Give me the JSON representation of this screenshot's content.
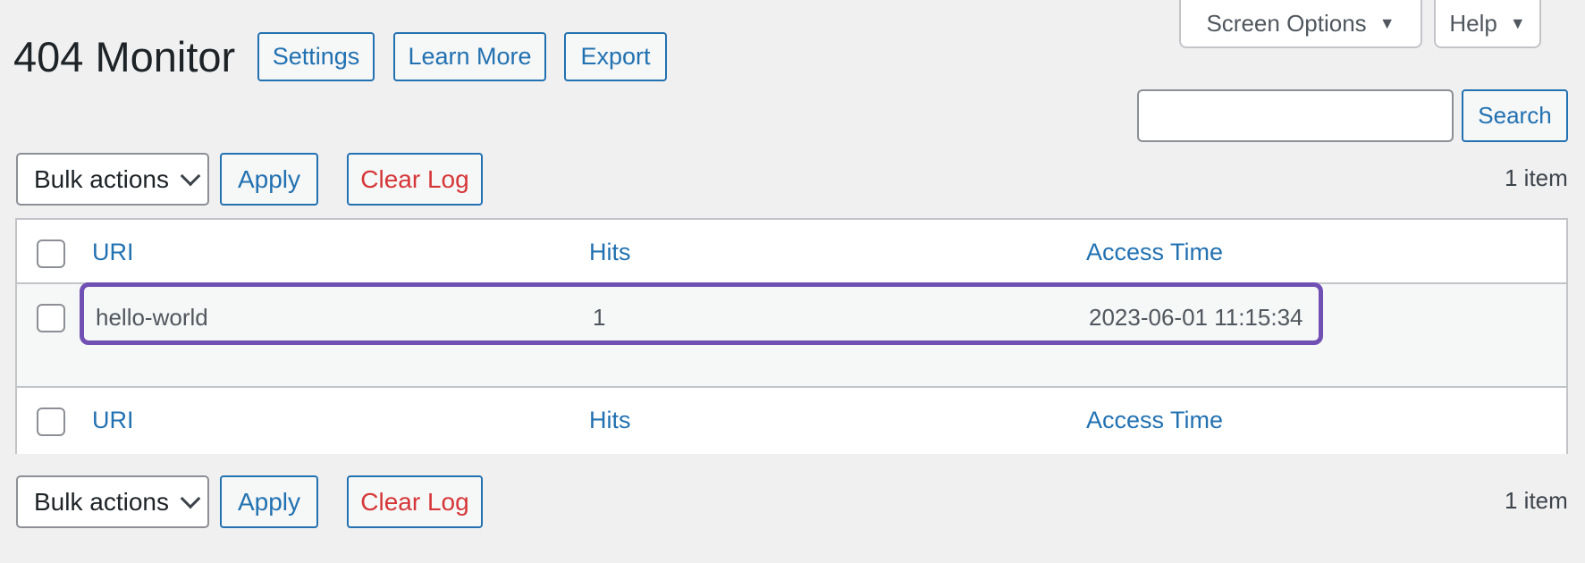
{
  "header": {
    "title": "404 Monitor",
    "buttons": [
      "Settings",
      "Learn More",
      "Export"
    ]
  },
  "top_tabs": {
    "screen_options": "Screen Options",
    "help": "Help"
  },
  "search": {
    "value": "",
    "placeholder": "",
    "button_label": "Search"
  },
  "tablenav_top": {
    "bulk_select": "Bulk actions",
    "apply": "Apply",
    "clear_log": "Clear Log",
    "count": "1 item"
  },
  "table": {
    "columns": [
      "URI",
      "Hits",
      "Access Time"
    ],
    "rows": [
      {
        "uri": "hello-world",
        "hits": "1",
        "access_time": "2023-06-01 11:15:34"
      }
    ]
  },
  "tablenav_bottom": {
    "bulk_select": "Bulk actions",
    "apply": "Apply",
    "clear_log": "Clear Log",
    "count": "1 item"
  },
  "colors": {
    "accent": "#2271b1",
    "danger": "#d63638",
    "highlight": "#7150b4",
    "background": "#f0f0f1"
  }
}
